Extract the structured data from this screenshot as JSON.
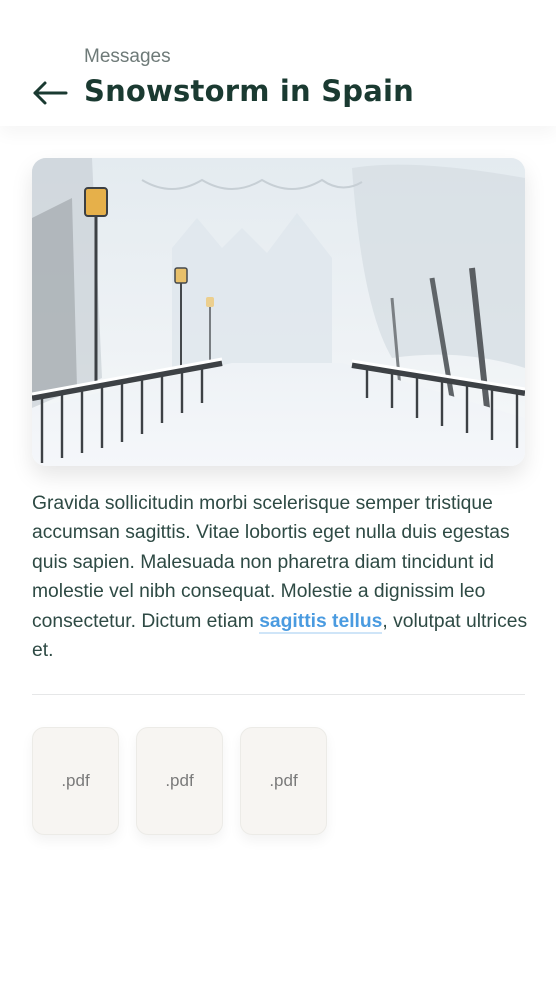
{
  "header": {
    "subtitle": "Messages",
    "title": "Snowstorm in Spain",
    "back_icon": "arrow-left-icon"
  },
  "hero_image": {
    "alt": "Snowy street with lamps and railings",
    "icon": "photo"
  },
  "body": {
    "text_before": "Gravida sollicitudin morbi scelerisque semper tristique accumsan sagittis. Vitae lobortis eget nulla duis egestas quis sapien. Malesuada non pharetra diam tincidunt id molestie vel nibh consequat. Molestie a dignissim leo consectetur. Dictum etiam ",
    "link_text": "sagittis tellus",
    "text_after": ", volutpat ultrices et."
  },
  "attachments": [
    {
      "label": ".pdf"
    },
    {
      "label": ".pdf"
    },
    {
      "label": ".pdf"
    }
  ],
  "colors": {
    "title": "#1a3a31",
    "subtitle": "#6e7a78",
    "link": "#4a9be0",
    "attachment_bg": "#f7f5f2"
  }
}
